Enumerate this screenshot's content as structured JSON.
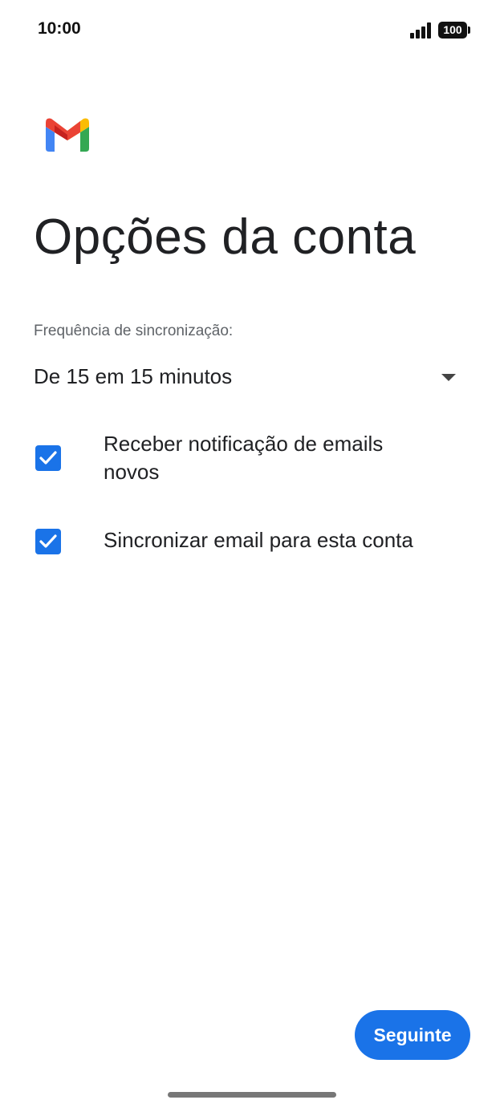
{
  "status_bar": {
    "time": "10:00",
    "battery": "100",
    "icons": [
      "signal-icon",
      "battery-icon"
    ]
  },
  "app": {
    "logo_icon": "gmail-logo-icon",
    "brand_colors": {
      "blue": "#4285F4",
      "red": "#EA4335",
      "yellow": "#FBBC04",
      "green": "#34A853"
    }
  },
  "page": {
    "title": "Opções da conta"
  },
  "sync": {
    "label": "Frequência de sincronização:",
    "selected": "De 15 em 15 minutos",
    "icon": "dropdown-arrow-icon"
  },
  "options": [
    {
      "label": "Receber notificação de emails novos",
      "checked": true
    },
    {
      "label": "Sincronizar email para esta conta",
      "checked": true
    }
  ],
  "footer": {
    "next_label": "Seguinte"
  },
  "colors": {
    "accent": "#1a73e8",
    "text": "#202124",
    "secondary_text": "#5f6368"
  }
}
